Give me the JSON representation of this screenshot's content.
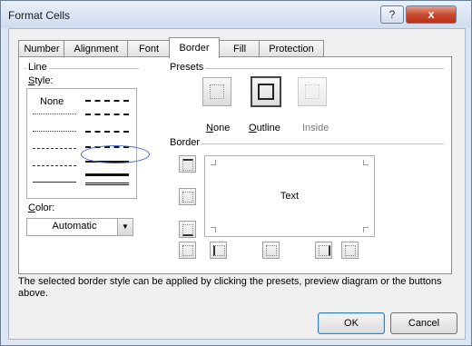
{
  "window": {
    "title": "Format Cells"
  },
  "titlebar": {
    "help_symbol": "?",
    "close_symbol": "x"
  },
  "tabs": [
    {
      "label": "Number"
    },
    {
      "label": "Alignment"
    },
    {
      "label": "Font"
    },
    {
      "label": "Border"
    },
    {
      "label": "Fill"
    },
    {
      "label": "Protection"
    }
  ],
  "active_tab": "Border",
  "line": {
    "group_label": "Line",
    "style_label": "Style:",
    "style_none": "None",
    "selected_style": "double",
    "color_label": "Color:",
    "color_value": "Automatic"
  },
  "presets": {
    "group_label": "Presets",
    "items": [
      {
        "label": "None",
        "icon": "preset-none-icon"
      },
      {
        "label": "Outline",
        "icon": "preset-outline-icon"
      },
      {
        "label": "Inside",
        "icon": "preset-inside-icon",
        "disabled": true
      }
    ]
  },
  "border": {
    "group_label": "Border",
    "preview_text": "Text"
  },
  "description": "The selected border style can be applied by clicking the presets, preview diagram or the buttons above.",
  "buttons": {
    "ok": "OK",
    "cancel": "Cancel"
  },
  "colors": {
    "title_bar": "#cfdcee",
    "dialog_bg": "#f0f0f0",
    "close_red": "#c84b31",
    "selection_ring": "#3b67c7"
  }
}
